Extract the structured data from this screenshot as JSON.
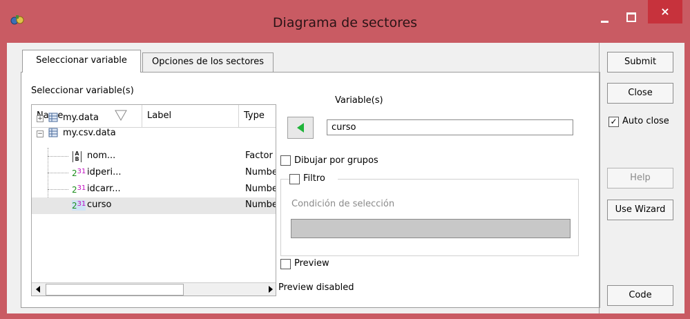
{
  "window": {
    "title": "Diagrama de sectores",
    "close_glyph": "×",
    "accent": "#c95b63",
    "icon": "app-icon"
  },
  "tabs": [
    {
      "label": "Seleccionar variable",
      "active": true
    },
    {
      "label": "Opciones de los sectores",
      "active": false
    }
  ],
  "source": {
    "label": "Seleccionar variable(s)",
    "columns": {
      "name": "Name",
      "label": "Label",
      "type": "Type"
    },
    "tree": [
      {
        "kind": "dataset",
        "name": "my.data",
        "expanded": false,
        "icon": "dataset-icon"
      },
      {
        "kind": "dataset",
        "name": "my.csv.data",
        "expanded": true,
        "icon": "dataset-icon"
      },
      {
        "kind": "variable",
        "name": "nom...",
        "type": "Factor",
        "icon": "factor-icon"
      },
      {
        "kind": "variable",
        "name": "idperi...",
        "type": "Numbe",
        "icon": "numeric-icon"
      },
      {
        "kind": "variable",
        "name": "idcarr...",
        "type": "Numbe",
        "icon": "numeric-icon"
      },
      {
        "kind": "variable",
        "name": "curso",
        "type": "Numbe",
        "icon": "numeric-icon",
        "selected": true
      }
    ],
    "numeric_icon_base": "2",
    "numeric_icon_power": "31"
  },
  "target": {
    "label": "Variable(s)",
    "value": "curso"
  },
  "options": {
    "group_checkbox_label": "Dibujar por grupos",
    "group_checked": false,
    "filter_label": "Filtro",
    "filter_checked": false,
    "condition_label": "Condición de selección",
    "condition_value": "",
    "preview_label": "Preview",
    "preview_checked": false,
    "preview_status": "Preview disabled"
  },
  "actions": {
    "submit": "Submit",
    "close": "Close",
    "auto_close_label": "Auto close",
    "auto_close_checked": true,
    "help": "Help",
    "use_wizard": "Use Wizard",
    "code": "Code"
  }
}
